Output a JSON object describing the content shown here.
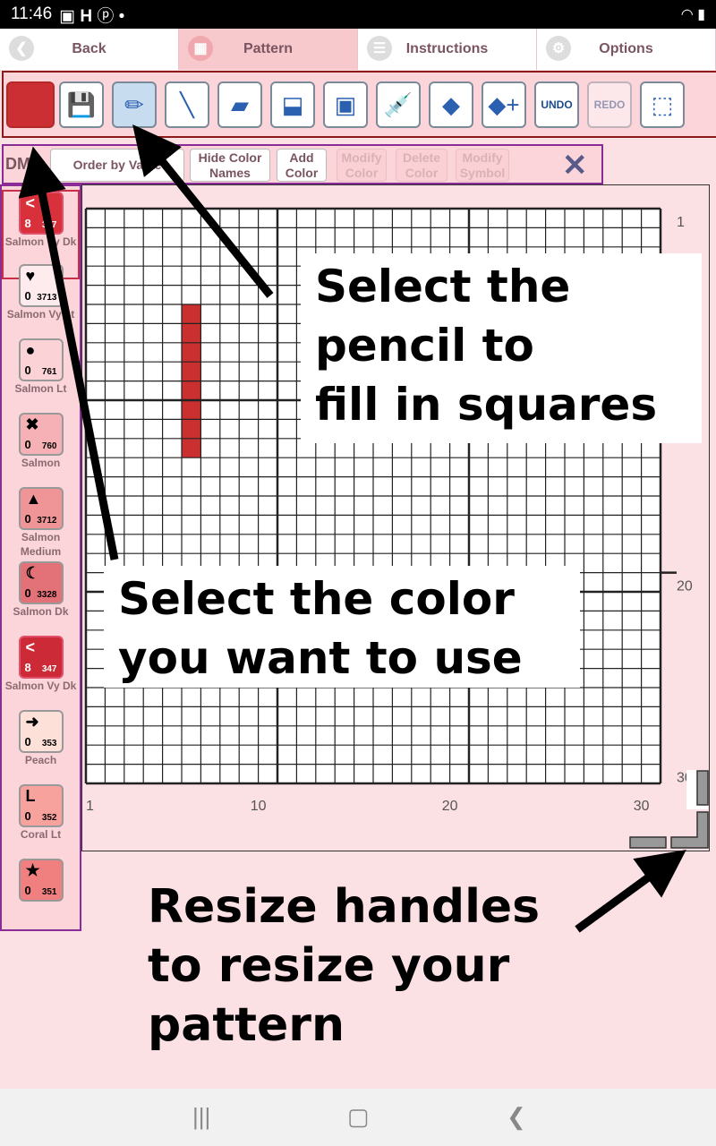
{
  "status_bar": {
    "time": "11:46",
    "icons": [
      "image-icon",
      "H",
      "pinterest-icon",
      "•"
    ],
    "right_icons": "wifi battery"
  },
  "tabs": [
    {
      "label": "Back",
      "icon": "back-icon"
    },
    {
      "label": "Pattern",
      "icon": "grid-icon",
      "active": true
    },
    {
      "label": "Instructions",
      "icon": "list-icon"
    },
    {
      "label": "Options",
      "icon": "gear-icon"
    }
  ],
  "toolbar": {
    "current_color": "#cc2f33",
    "tools": [
      {
        "name": "save",
        "glyph": "💾"
      },
      {
        "name": "pencil",
        "glyph": "✏",
        "selected": true
      },
      {
        "name": "line",
        "glyph": "╲"
      },
      {
        "name": "eraser",
        "glyph": "▰"
      },
      {
        "name": "stamp",
        "glyph": "⬓"
      },
      {
        "name": "border",
        "glyph": "▣"
      },
      {
        "name": "eyedropper",
        "glyph": "💉"
      },
      {
        "name": "fill",
        "glyph": "◆"
      },
      {
        "name": "fill-add",
        "glyph": "◆+"
      },
      {
        "name": "undo",
        "label": "UNDO"
      },
      {
        "name": "redo",
        "label": "REDO",
        "disabled": true
      },
      {
        "name": "select",
        "glyph": "⬚"
      }
    ]
  },
  "color_bar": {
    "prefix": "DM",
    "order": "Order by Value",
    "hide": "Hide Color Names",
    "add": "Add Color",
    "modify": "Modify Color",
    "delete": "Delete Color",
    "modify_symbol": "Modify Symbol",
    "close": "✕"
  },
  "palette": [
    {
      "symbol": "<",
      "count": "8",
      "number": "347",
      "name": "Salmon Vy Dk",
      "color": "#d8313b",
      "selected": true
    },
    {
      "symbol": "♥",
      "count": "0",
      "number": "3713",
      "name": "Salmon Vy Lt",
      "color": "#fdebed"
    },
    {
      "symbol": "●",
      "count": "0",
      "number": "761",
      "name": "Salmon Lt",
      "color": "#fbd3d6"
    },
    {
      "symbol": "✖",
      "count": "0",
      "number": "760",
      "name": "Salmon",
      "color": "#f5b1b5"
    },
    {
      "symbol": "▲",
      "count": "0",
      "number": "3712",
      "name": "Salmon Medium",
      "color": "#ef9598"
    },
    {
      "symbol": "☾",
      "count": "0",
      "number": "3328",
      "name": "Salmon Dk",
      "color": "#e37278"
    },
    {
      "symbol": "<",
      "count": "8",
      "number": "347",
      "name": "Salmon Vy Dk",
      "color": "#cc2a36"
    },
    {
      "symbol": "➜",
      "count": "0",
      "number": "353",
      "name": "Peach",
      "color": "#fde0d8"
    },
    {
      "symbol": "L",
      "count": "0",
      "number": "352",
      "name": "Coral Lt",
      "color": "#f8a29e"
    },
    {
      "symbol": "★",
      "count": "0",
      "number": "351",
      "name": "",
      "color": "#f08080"
    }
  ],
  "grid": {
    "columns": 30,
    "rows": 30,
    "x_labels": [
      "1",
      "10",
      "20",
      "30"
    ],
    "y_labels": [
      "1",
      "20",
      "30"
    ],
    "filled": {
      "color": "#c9302f",
      "column": 6,
      "rows": [
        6,
        7,
        8,
        9,
        10,
        11,
        12,
        13
      ]
    }
  },
  "callouts": {
    "pencil": "Select the pencil to fill in squares",
    "color": "Select the color you want to use",
    "resize": "Resize handles to resize your pattern"
  },
  "callout_lines": {
    "pencil": [
      "Select the",
      "pencil to",
      "fill in squares"
    ],
    "color": [
      "Select the color",
      "you want to use"
    ],
    "resize": [
      "Resize handles",
      "to resize your",
      "pattern"
    ]
  }
}
